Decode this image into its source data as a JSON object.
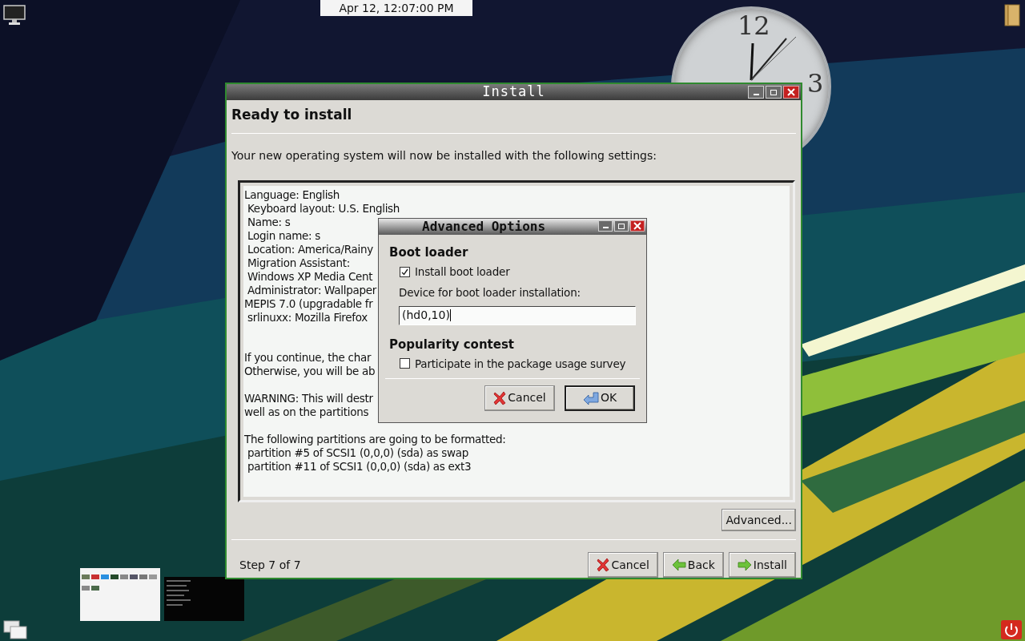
{
  "desktop": {
    "datetime": "Apr 12, 12:07:00 PM",
    "clock_numerals": [
      "12",
      "3"
    ]
  },
  "install_window": {
    "title": "Install",
    "heading": "Ready to install",
    "intro": "Your new operating system will now be installed with the following settings:",
    "summary_paragraphs": [
      [
        "Language: English",
        " Keyboard layout: U.S. English",
        " Name: s",
        " Login name: s",
        " Location: America/Rainy",
        " Migration Assistant:",
        " Windows XP Media Cent",
        " Administrator: Wallpaper",
        "MEPIS 7.0 (upgradable fr",
        " srlinuxx: Mozilla Firefox"
      ],
      [
        "If you continue, the char",
        "Otherwise, you will be ab"
      ],
      [
        "WARNING: This will destr",
        "well as on the partitions"
      ],
      [
        "The following partitions are going to be formatted:",
        " partition #5 of SCSI1 (0,0,0) (sda) as swap",
        " partition #11 of SCSI1 (0,0,0) (sda) as ext3"
      ]
    ],
    "advanced_button": "Advanced...",
    "step": "Step 7 of 7",
    "buttons": [
      {
        "label": "Cancel",
        "kind": "cancel"
      },
      {
        "label": "Back",
        "kind": "back"
      },
      {
        "label": "Install",
        "kind": "install"
      }
    ]
  },
  "advanced_dialog": {
    "title": "Advanced Options",
    "sections": [
      {
        "heading": "Boot loader",
        "checkbox": {
          "label": "Install boot loader",
          "checked": true
        },
        "field_label": "Device for boot loader installation:",
        "field_value": "(hd0,10)"
      },
      {
        "heading": "Popularity contest",
        "checkbox": {
          "label": "Participate in the package usage survey",
          "checked": false
        }
      }
    ],
    "buttons": [
      {
        "label": "Cancel",
        "kind": "cancel",
        "default": false
      },
      {
        "label": "OK",
        "kind": "ok",
        "default": true
      }
    ]
  }
}
